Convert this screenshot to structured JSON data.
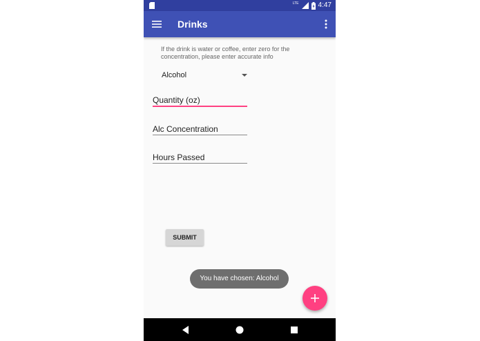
{
  "status_bar": {
    "time": "4:47",
    "network_label": "LTE",
    "icons": [
      "sd-card-icon",
      "signal-icon",
      "battery-icon"
    ]
  },
  "app_bar": {
    "title": "Drinks",
    "icons": [
      "menu-icon",
      "overflow-menu-icon"
    ]
  },
  "form": {
    "instructions": "If the drink is water or coffee, enter zero for the concentration, please enter accurate info",
    "drink_type": {
      "selected": "Alcohol"
    },
    "fields": [
      {
        "placeholder": "Quantity (oz)",
        "value": "",
        "focused": true
      },
      {
        "placeholder": "Alc Concentration",
        "value": "",
        "focused": false
      },
      {
        "placeholder": "Hours Passed",
        "value": "",
        "focused": false
      }
    ],
    "submit_label": "SUBMIT"
  },
  "toast": {
    "message": "You have chosen: Alcohol"
  },
  "fab": {
    "icon": "plus-icon"
  },
  "nav_bar": {
    "icons": [
      "back-icon",
      "home-icon",
      "recents-icon"
    ]
  },
  "colors": {
    "status_bar": "#303f9f",
    "app_bar": "#3f51b5",
    "accent": "#ff4081",
    "toast": "#6e6e6e",
    "nav_bar": "#000000"
  }
}
